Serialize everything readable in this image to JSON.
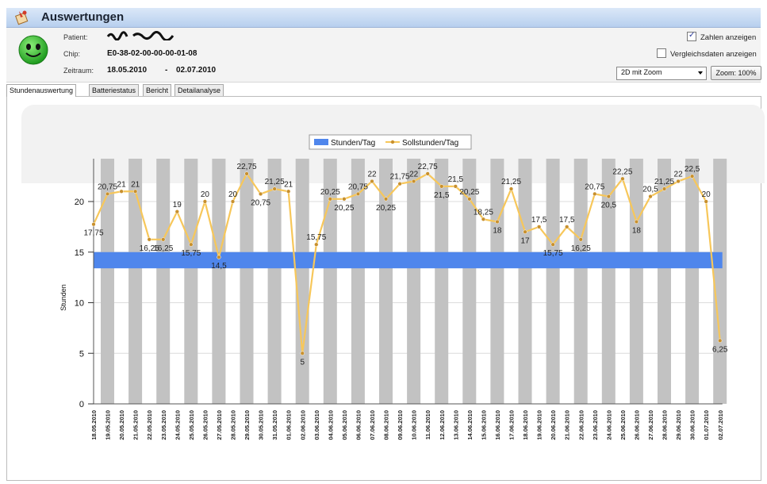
{
  "window": {
    "title": "Auswertungen"
  },
  "patient": {
    "patient_label": "Patient:",
    "chip_label": "Chip:",
    "chip_value": "E0-38-02-00-00-00-01-08",
    "zeitraum_label": "Zeitraum:",
    "zeitraum_from": "18.05.2010",
    "zeitraum_sep": "-",
    "zeitraum_to": "02.07.2010"
  },
  "options": {
    "zahlen_anzeigen": "Zahlen anzeigen",
    "zahlen_checked": true,
    "vergleichsdaten": "Vergleichsdaten anzeigen",
    "vergleichsdaten_checked": false,
    "view_select": "2D mit Zoom",
    "zoom_button": "Zoom: 100%"
  },
  "tabs": [
    "Stundenauswertung",
    "Batteriestatus",
    "Bericht",
    "Detailanalyse"
  ],
  "colors": {
    "band": "#4f86ec",
    "line": "#f7c75a",
    "marker": "#c8902d",
    "stripe": "#c2c2c2"
  },
  "chart_data": {
    "type": "line",
    "ylabel": "Stunden",
    "ylim": [
      0,
      23
    ],
    "yticks": [
      0,
      5,
      10,
      15,
      20
    ],
    "legend": [
      "Stunden/Tag",
      "Sollstunden/Tag"
    ],
    "legend_position": "top-center",
    "band": {
      "name": "Stunden/Tag",
      "from": 13.4,
      "to": 15.0
    },
    "categories": [
      "18.05.2010",
      "19.05.2010",
      "20.05.2010",
      "21.05.2010",
      "22.05.2010",
      "23.05.2010",
      "24.05.2010",
      "25.05.2010",
      "26.05.2010",
      "27.05.2010",
      "28.05.2010",
      "29.05.2010",
      "30.05.2010",
      "31.05.2010",
      "01.06.2010",
      "02.06.2010",
      "03.06.2010",
      "04.06.2010",
      "05.06.2010",
      "06.06.2010",
      "07.06.2010",
      "08.06.2010",
      "09.06.2010",
      "10.06.2010",
      "11.06.2010",
      "12.06.2010",
      "13.06.2010",
      "14.06.2010",
      "15.06.2010",
      "16.06.2010",
      "17.06.2010",
      "18.06.2010",
      "19.06.2010",
      "20.06.2010",
      "21.06.2010",
      "22.06.2010",
      "23.06.2010",
      "24.06.2010",
      "25.06.2010",
      "26.06.2010",
      "27.06.2010",
      "28.06.2010",
      "29.06.2010",
      "30.06.2010",
      "01.07.2010",
      "02.07.2010"
    ],
    "series": [
      {
        "name": "Sollstunden/Tag",
        "values": [
          17.75,
          20.75,
          21,
          21,
          16.25,
          16.25,
          19,
          15.75,
          20,
          14.5,
          20,
          22.75,
          20.75,
          21.25,
          21,
          5,
          15.75,
          20.25,
          20.25,
          20.75,
          22,
          20.25,
          21.75,
          22,
          22.75,
          21.5,
          21.5,
          20.25,
          18.25,
          18,
          21.25,
          17,
          17.5,
          15.75,
          17.5,
          16.25,
          20.75,
          20.5,
          22.25,
          18,
          20.5,
          21.25,
          22,
          22.5,
          20,
          6.25
        ]
      }
    ],
    "labels": [
      "17,75",
      "20,75",
      "21",
      "21",
      "16,25",
      "16,25",
      "19",
      "15,75",
      "20",
      "14,5",
      "20",
      "22,75",
      "20,75",
      "21,25",
      "21",
      "5",
      "15,75",
      "20,25",
      "20,25",
      "20,75",
      "22",
      "20,25",
      "21,75",
      "22",
      "22,75",
      "21,5",
      "21,5",
      "20,25",
      "18,25",
      "18",
      "21,25",
      "17",
      "17,5",
      "15,75",
      "17,5",
      "16,25",
      "20,75",
      "20,5",
      "22,25",
      "18",
      "20,5",
      "21,25",
      "22",
      "22,5",
      "20",
      "6,25"
    ],
    "grid": true
  }
}
